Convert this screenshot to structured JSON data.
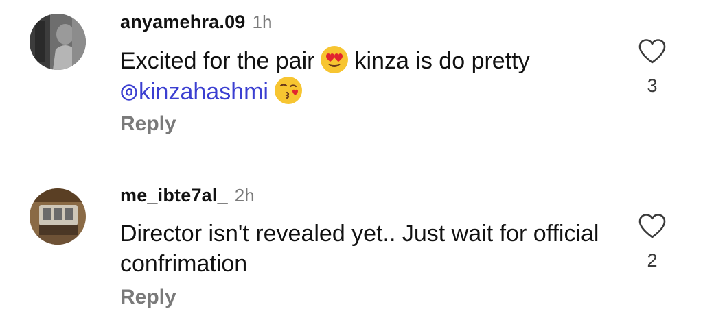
{
  "comments": [
    {
      "username": "anyamehra.09",
      "time": "1h",
      "text_before_emoji": "Excited for the pair",
      "emoji_1": "heart-eyes-emoji",
      "text_after_emoji": "kinza is do pretty",
      "mention": "kinzahashmi",
      "emoji_2": "kissing-heart-emoji",
      "reply_label": "Reply",
      "like_count": "3"
    },
    {
      "username": "me_ibte7al_",
      "time": "2h",
      "text": "Director isn't revealed yet.. Just wait for official confrimation",
      "reply_label": "Reply",
      "like_count": "2"
    }
  ],
  "colors": {
    "text": "#111111",
    "secondary": "#7a7a7a",
    "mention": "#3b3fd1",
    "heart_outline": "#3a3a3a"
  },
  "icons": {
    "like": "heart-outline-icon",
    "mention": "threads-at-icon"
  }
}
